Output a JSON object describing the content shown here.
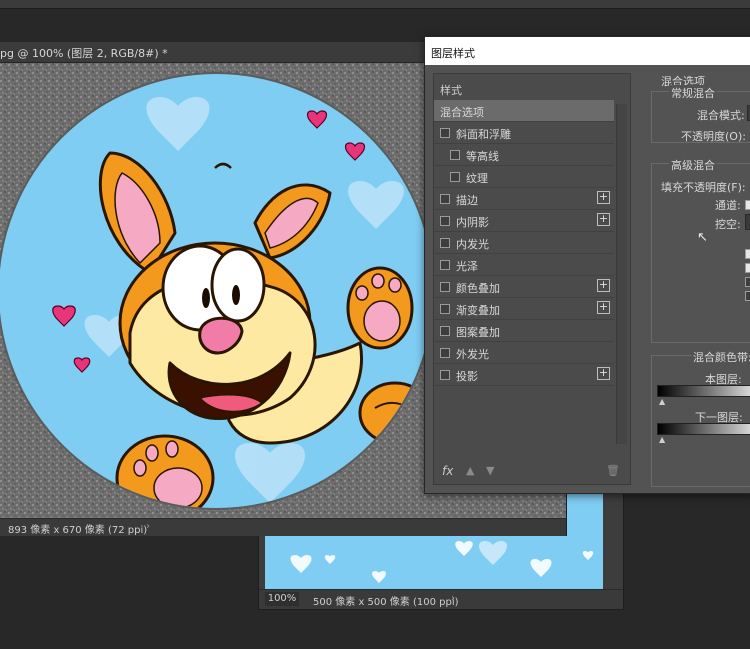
{
  "top_doc": {
    "tab_title": "pg @ 100% (图层 2, RGB/8#) *",
    "status_dims": "893 像素 x 670 像素 (72 ppi)",
    "status_arrow": "›"
  },
  "back_doc": {
    "zoom": "100%",
    "status_dims": "500 像素 x 500 像素 (100 ppi)",
    "status_arrow": "›"
  },
  "dialog": {
    "title": "图层样式",
    "list_header": "样式",
    "items": [
      {
        "label": "混合选项",
        "checkbox": false,
        "plus": false,
        "selected": true,
        "indent": 0
      },
      {
        "label": "斜面和浮雕",
        "checkbox": true,
        "plus": false,
        "indent": 0
      },
      {
        "label": "等高线",
        "checkbox": true,
        "plus": false,
        "indent": 1
      },
      {
        "label": "纹理",
        "checkbox": true,
        "plus": false,
        "indent": 1
      },
      {
        "label": "描边",
        "checkbox": true,
        "plus": true,
        "indent": 0
      },
      {
        "label": "内阴影",
        "checkbox": true,
        "plus": true,
        "indent": 0
      },
      {
        "label": "内发光",
        "checkbox": true,
        "plus": false,
        "indent": 0
      },
      {
        "label": "光泽",
        "checkbox": true,
        "plus": false,
        "indent": 0
      },
      {
        "label": "颜色叠加",
        "checkbox": true,
        "plus": true,
        "indent": 0
      },
      {
        "label": "渐变叠加",
        "checkbox": true,
        "plus": true,
        "indent": 0
      },
      {
        "label": "图案叠加",
        "checkbox": true,
        "plus": false,
        "indent": 0
      },
      {
        "label": "外发光",
        "checkbox": true,
        "plus": false,
        "indent": 0
      },
      {
        "label": "投影",
        "checkbox": true,
        "plus": true,
        "indent": 0
      }
    ],
    "fx_label": "fx",
    "blend": {
      "section_title": "混合选项",
      "general_title": "常规混合",
      "blend_mode_label": "混合模式:",
      "opacity_label": "不透明度(O):",
      "advanced_title": "高级混合",
      "fill_opacity_label": "填充不透明度(F):",
      "channels_label": "通道:",
      "knockout_label": "挖空:",
      "blend_if_label": "混合颜色带:",
      "this_layer_label": "本图层:",
      "underlying_label": "下一图层:"
    }
  },
  "colors": {
    "accent_sky": "#7fcdf3",
    "dog_orange": "#f39a1e",
    "dog_cream": "#fde9a2",
    "heart_pink": "#e8357a",
    "app_bg": "#282828"
  }
}
